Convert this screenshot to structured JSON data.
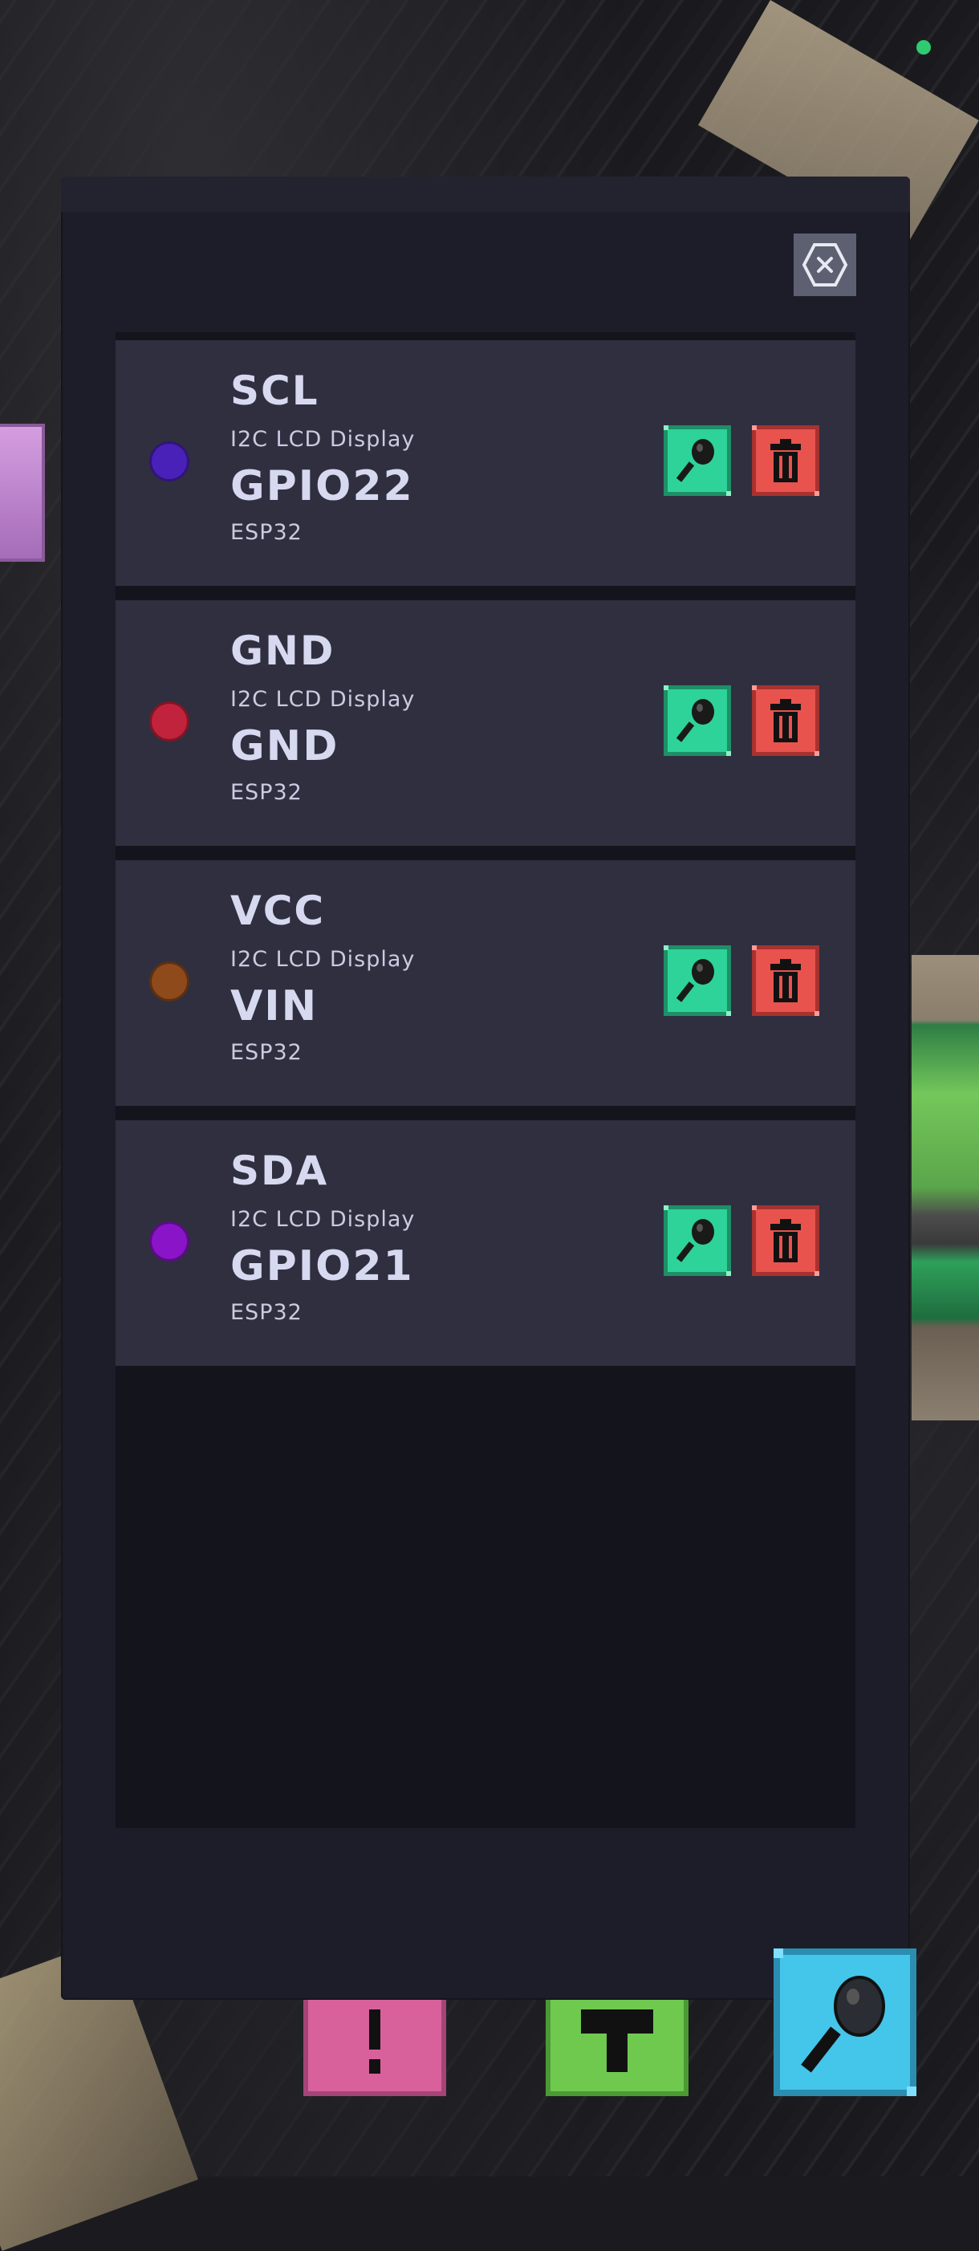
{
  "dialog": {
    "close_label": "close"
  },
  "connections": [
    {
      "pin": "SCL",
      "component": "I2C LCD Display",
      "target_pin": "GPIO22",
      "target_component": "ESP32",
      "color": "#4a21b8"
    },
    {
      "pin": "GND",
      "component": "I2C LCD Display",
      "target_pin": "GND",
      "target_component": "ESP32",
      "color": "#c0233b"
    },
    {
      "pin": "VCC",
      "component": "I2C LCD Display",
      "target_pin": "VIN",
      "target_component": "ESP32",
      "color": "#8e4a1b"
    },
    {
      "pin": "SDA",
      "component": "I2C LCD Display",
      "target_pin": "GPIO21",
      "target_component": "ESP32",
      "color": "#8a14c8"
    }
  ],
  "row_actions": {
    "probe_icon": "probe-icon",
    "delete_icon": "trash-icon"
  },
  "toolbar": {
    "items": [
      {
        "icon": "exclamation-icon",
        "color": "#d9619b"
      },
      {
        "icon": "hammer-icon",
        "color": "#6fc94f"
      },
      {
        "icon": "probe-icon",
        "color": "#43c6ea"
      }
    ]
  },
  "colors": {
    "panel": "#1d1d29",
    "row": "#2f2f40",
    "text": "#d7d9f0",
    "probe_button": "#2ed399",
    "delete_button": "#e8534e"
  }
}
